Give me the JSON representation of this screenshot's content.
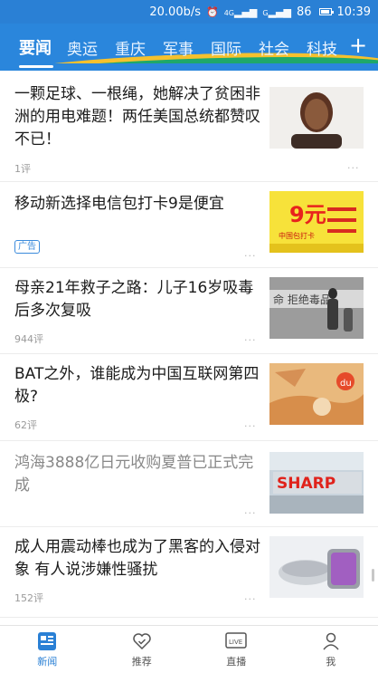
{
  "status_bar": {
    "speed": "20.00b/s",
    "signal_label": "4G",
    "signal_label_2": "G",
    "battery": "86",
    "battery_level": 0.86,
    "time": "10:39"
  },
  "tabs": [
    "要闻",
    "奥运",
    "重庆",
    "军事",
    "国际",
    "社会",
    "科技"
  ],
  "add_tab_label": "+",
  "articles": [
    {
      "title": "一颗足球、一根绳，她解决了贫困非洲的用电难题！两任美国总统都赞叹不已！",
      "comments": "1评",
      "read": false
    },
    {
      "title": "移动新选择电信包打卡9是便宜",
      "ad_badge": "广告",
      "thumb_text_big": "9元",
      "thumb_text_small": "中国包打卡",
      "read": false
    },
    {
      "title": "母亲21年救子之路：儿子16岁吸毒后多次复吸",
      "comments": "944评",
      "thumb_text": "命 拒绝毒品",
      "read": false
    },
    {
      "title": "BAT之外，谁能成为中国互联网第四极?",
      "comments": "62评",
      "thumb_text": "du",
      "read": false
    },
    {
      "title": "鸿海3888亿日元收购夏普已正式完成",
      "thumb_text": "SHARP",
      "read": true
    },
    {
      "title": "成人用震动棒也成为了黑客的入侵对象 有人说涉嫌性骚扰",
      "comments": "152评",
      "read": false
    }
  ],
  "more_label": "...",
  "bottom_nav": [
    {
      "label": "新闻",
      "icon": "news-icon",
      "active": true
    },
    {
      "label": "推荐",
      "icon": "heart-check-icon",
      "active": false
    },
    {
      "label": "直播",
      "icon": "live-tv-icon",
      "icon_text": "LIVE",
      "active": false
    },
    {
      "label": "我",
      "icon": "person-icon",
      "active": false
    }
  ],
  "colors": {
    "header_blue": "#2a86dc",
    "accent_yellow": "#f5c12e",
    "accent_green": "#1fa86a"
  }
}
